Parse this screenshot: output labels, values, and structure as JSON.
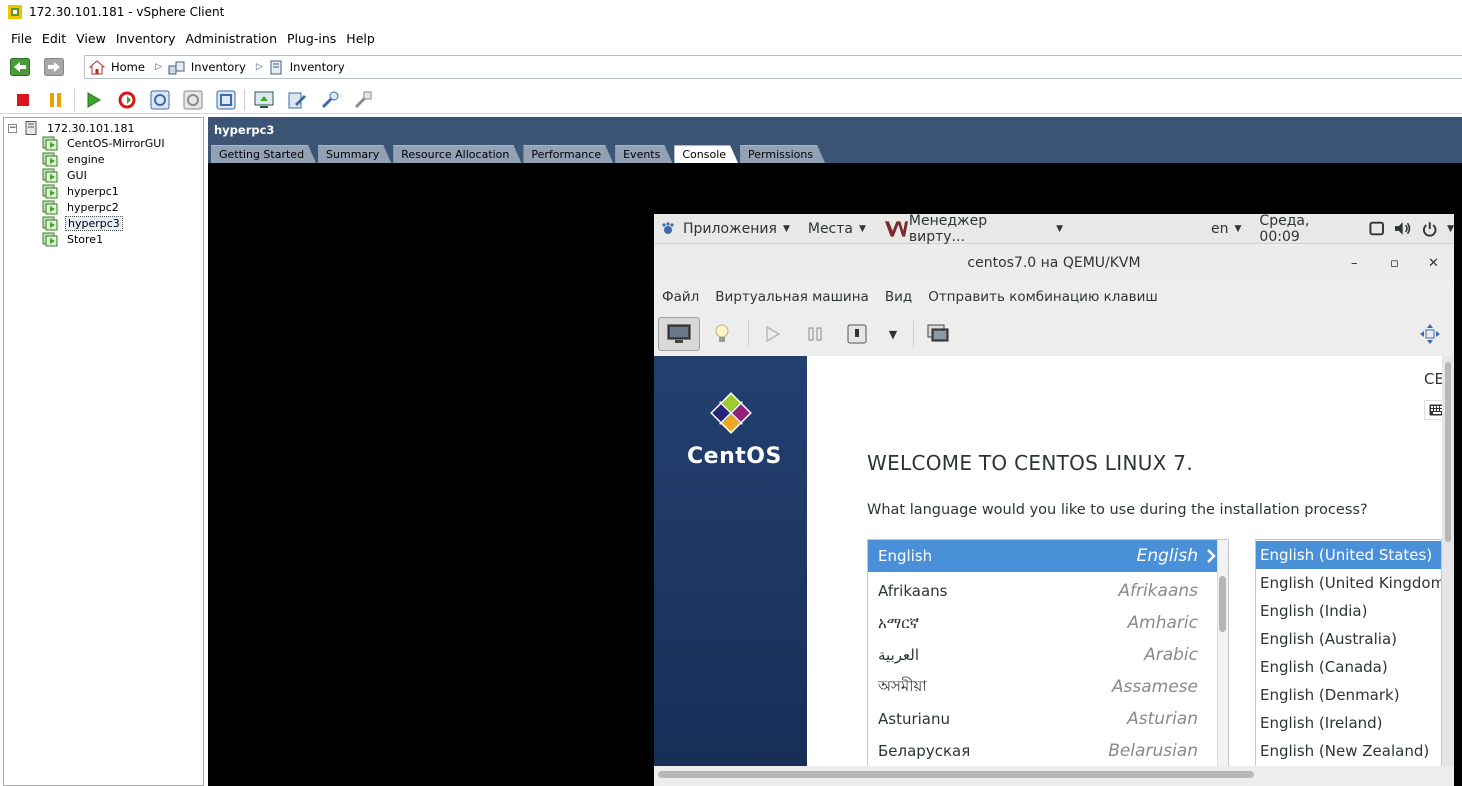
{
  "window": {
    "title": "172.30.101.181 - vSphere Client"
  },
  "menubar": [
    "File",
    "Edit",
    "View",
    "Inventory",
    "Administration",
    "Plug-ins",
    "Help"
  ],
  "breadcrumb": [
    "Home",
    "Inventory",
    "Inventory"
  ],
  "tree": {
    "root": "172.30.101.181",
    "items": [
      "CentOS-MirrorGUI",
      "engine",
      "GUI",
      "hyperpc1",
      "hyperpc2",
      "hyperpc3",
      "Store1"
    ],
    "selected": "hyperpc3"
  },
  "vm": {
    "name": "hyperpc3",
    "tabs": [
      "Getting Started",
      "Summary",
      "Resource Allocation",
      "Performance",
      "Events",
      "Console",
      "Permissions"
    ],
    "active_tab": "Console"
  },
  "gnome_bar": {
    "apps": "Приложения",
    "places": "Места",
    "window": "Менеджер вирту...",
    "lang": "en",
    "clock": "Среда, 00:09"
  },
  "vmm": {
    "title": "centos7.0 на QEMU/KVM",
    "menu": [
      "Файл",
      "Виртуальная машина",
      "Вид",
      "Отправить комбинацию клавиш"
    ],
    "min": "–",
    "max": "▫",
    "close": "✕"
  },
  "installer": {
    "brand": "CentOS",
    "ce": "CE",
    "welcome": "WELCOME TO CENTOS LINUX 7.",
    "question": "What language would you like to use during the installation process?",
    "languages": [
      {
        "native": "English",
        "english": "English"
      },
      {
        "native": "Afrikaans",
        "english": "Afrikaans"
      },
      {
        "native": "አማርኛ",
        "english": "Amharic"
      },
      {
        "native": "العربية",
        "english": "Arabic"
      },
      {
        "native": "অসমীয়া",
        "english": "Assamese"
      },
      {
        "native": "Asturianu",
        "english": "Asturian"
      },
      {
        "native": "Беларуская",
        "english": "Belarusian"
      }
    ],
    "locales": [
      "English (United States)",
      "English (United Kingdom)",
      "English (India)",
      "English (Australia)",
      "English (Canada)",
      "English (Denmark)",
      "English (Ireland)",
      "English (New Zealand)"
    ]
  },
  "colors": {
    "vm_header": "#3d5574",
    "selection": "#4a90d9",
    "anaconda_side": "#1c3662"
  }
}
